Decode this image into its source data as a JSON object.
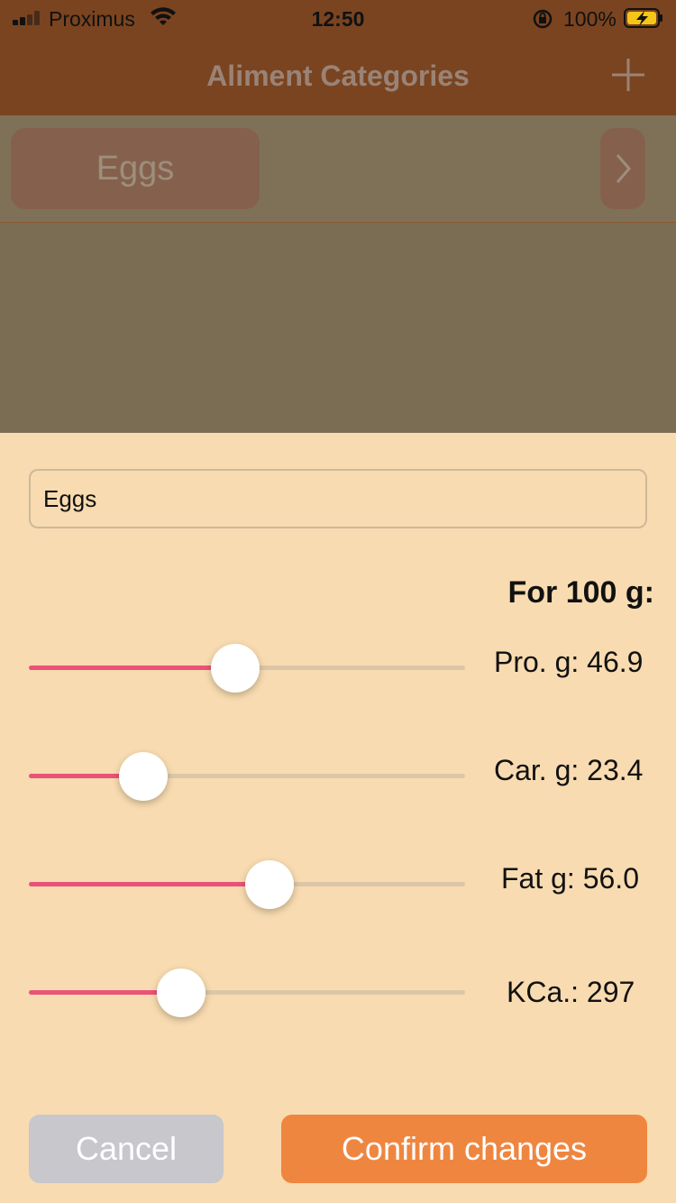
{
  "status_bar": {
    "carrier": "Proximus",
    "time": "12:50",
    "battery_percent": "100%",
    "icons": [
      "signal-icon",
      "wifi-icon",
      "orientation-lock-icon",
      "battery-charging-icon"
    ]
  },
  "nav": {
    "title": "Aliment Categories",
    "add_icon": "plus-icon"
  },
  "list": {
    "items": [
      {
        "label": "Eggs",
        "chevron_icon": "chevron-right-icon"
      }
    ]
  },
  "sheet": {
    "name_value": "Eggs",
    "unit_heading": "For 100 g:",
    "sliders": [
      {
        "label": "Pro. g: 46.9",
        "fraction": 0.473
      },
      {
        "label": "Car. g: 23.4",
        "fraction": 0.262
      },
      {
        "label": "Fat g: 56.0",
        "fraction": 0.552
      },
      {
        "label": "KCa.: 297",
        "fraction": 0.349
      }
    ],
    "cancel_label": "Cancel",
    "confirm_label": "Confirm changes"
  },
  "colors": {
    "header": "#7a4420",
    "sheet_background": "#f8dbb0",
    "slider_fill": "#ea5377",
    "confirm": "#ef8640",
    "cancel": "#c7c7cc"
  }
}
